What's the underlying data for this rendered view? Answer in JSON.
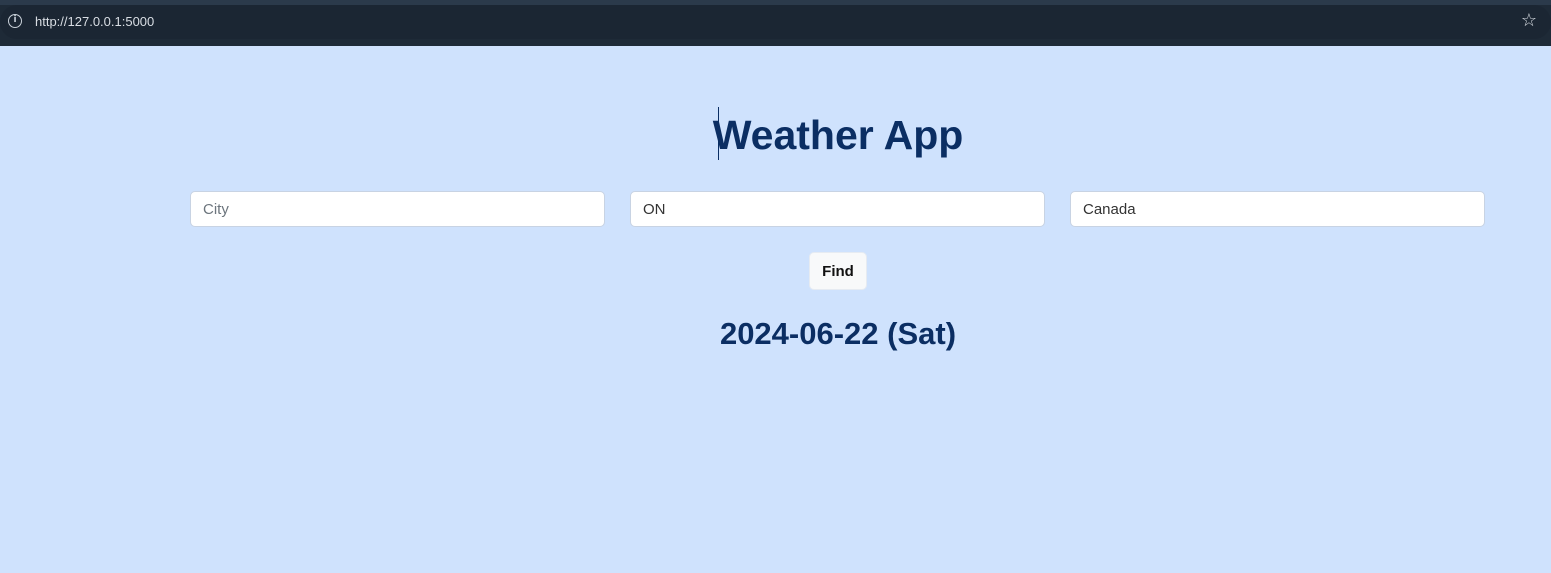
{
  "browser": {
    "url": "http://127.0.0.1:5000",
    "info_icon": "info-icon",
    "bookmark_icon": "star-icon"
  },
  "app": {
    "title": "Weather App",
    "city_placeholder": "City",
    "state_value": "ON",
    "country_value": "Canada",
    "find_label": "Find",
    "date_text": "2024-06-22 (Sat)"
  },
  "colors": {
    "page_background": "#cfe2fd",
    "heading": "#0b2e63",
    "browser_bar": "#1e2a37"
  }
}
